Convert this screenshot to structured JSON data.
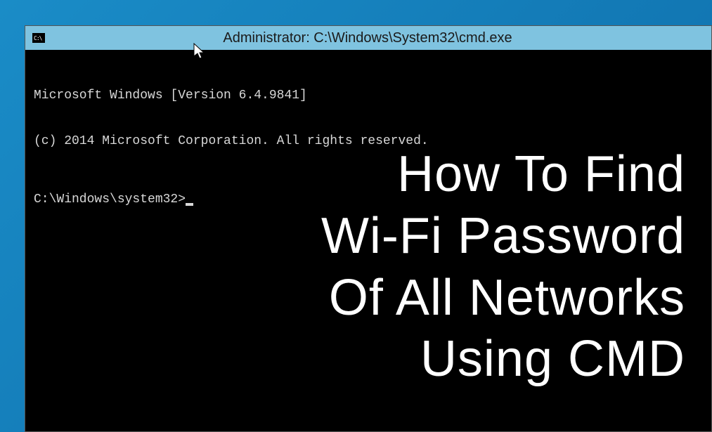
{
  "window": {
    "title": "Administrator: C:\\Windows\\System32\\cmd.exe"
  },
  "terminal": {
    "line1": "Microsoft Windows [Version 6.4.9841]",
    "line2": "(c) 2014 Microsoft Corporation. All rights reserved.",
    "prompt": "C:\\Windows\\system32>"
  },
  "overlay": {
    "line1": "How To Find",
    "line2": "Wi-Fi Password",
    "line3": "Of All Networks",
    "line4": "Using CMD"
  }
}
